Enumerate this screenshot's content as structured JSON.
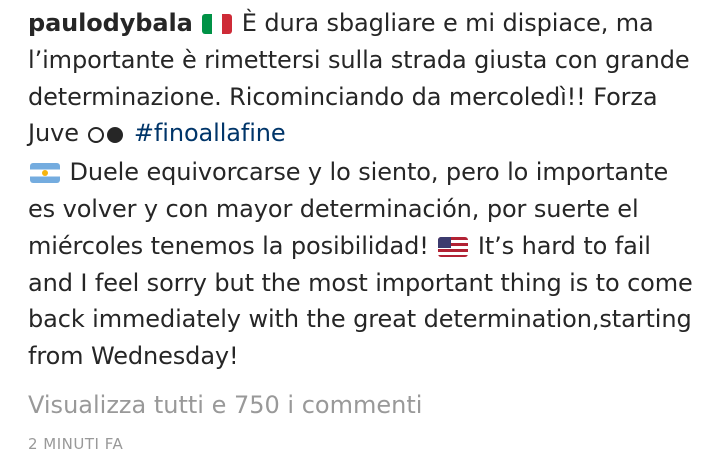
{
  "post": {
    "username": "paulodybala",
    "caption_it": " È dura sbagliare e mi dispiace, ma l’importante è rimettersi sulla strada giusta con grande determinazione. Ricominciando da mercoledì!! Forza Juve ",
    "hashtag": "#finoallafine",
    "caption_es": " Duele equivorcarse y lo siento, pero lo importante es volver y con mayor determinación, por suerte el miércoles tenemos la posibilidad! ",
    "caption_en": " It’s hard to fail and I feel sorry but the most important thing is to come back immediately  with the great determination,starting from Wednesday!",
    "emoji": {
      "italy_flag": "flag-italy-icon",
      "argentina_flag": "flag-argentina-icon",
      "usa_flag": "flag-usa-icon",
      "juve_circles": "white-circle-black-circle-icon"
    },
    "view_comments": "Visualizza tutti e 750 i commenti",
    "timestamp": "2 MINUTI FA"
  },
  "colors": {
    "text": "#262626",
    "hashtag": "#003569",
    "muted": "#999999"
  }
}
